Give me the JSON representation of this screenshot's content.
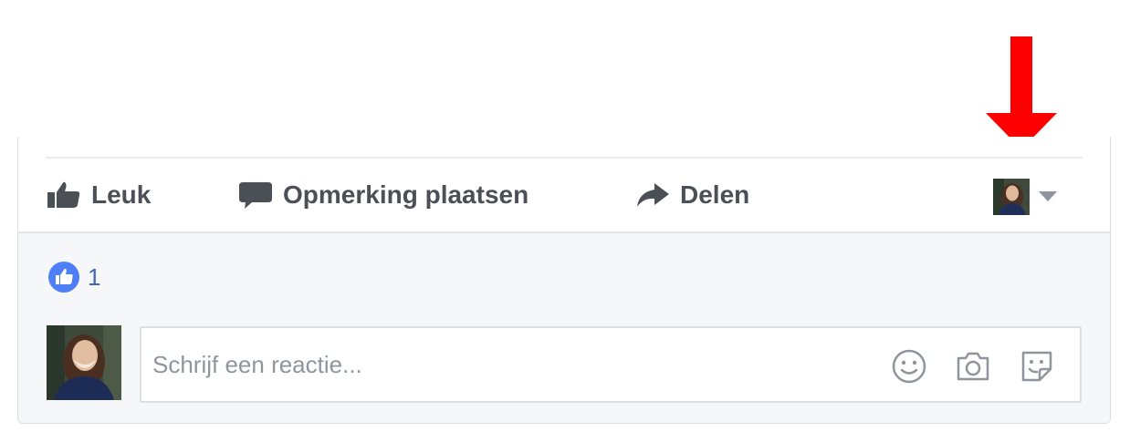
{
  "post_actions": {
    "like_label": "Leuk",
    "comment_label": "Opmerking plaatsen",
    "share_label": "Delen"
  },
  "reactions": {
    "count": "1"
  },
  "composer": {
    "placeholder": "Schrijf een reactie..."
  },
  "icons": {
    "like": "thumbs-up-icon",
    "comment": "speech-bubble-icon",
    "share": "share-arrow-icon",
    "audience_caret": "caret-down-icon",
    "emoji": "smiley-icon",
    "camera": "camera-icon",
    "sticker": "sticker-icon",
    "annotation": "red-down-arrow"
  },
  "colors": {
    "action_text": "#4b4f56",
    "like_badge": "#4e7ff7",
    "reaction_count": "#4267b2",
    "feedback_bg": "#f6f7f9",
    "annotation_arrow": "#ff0000",
    "placeholder": "#90949c"
  }
}
